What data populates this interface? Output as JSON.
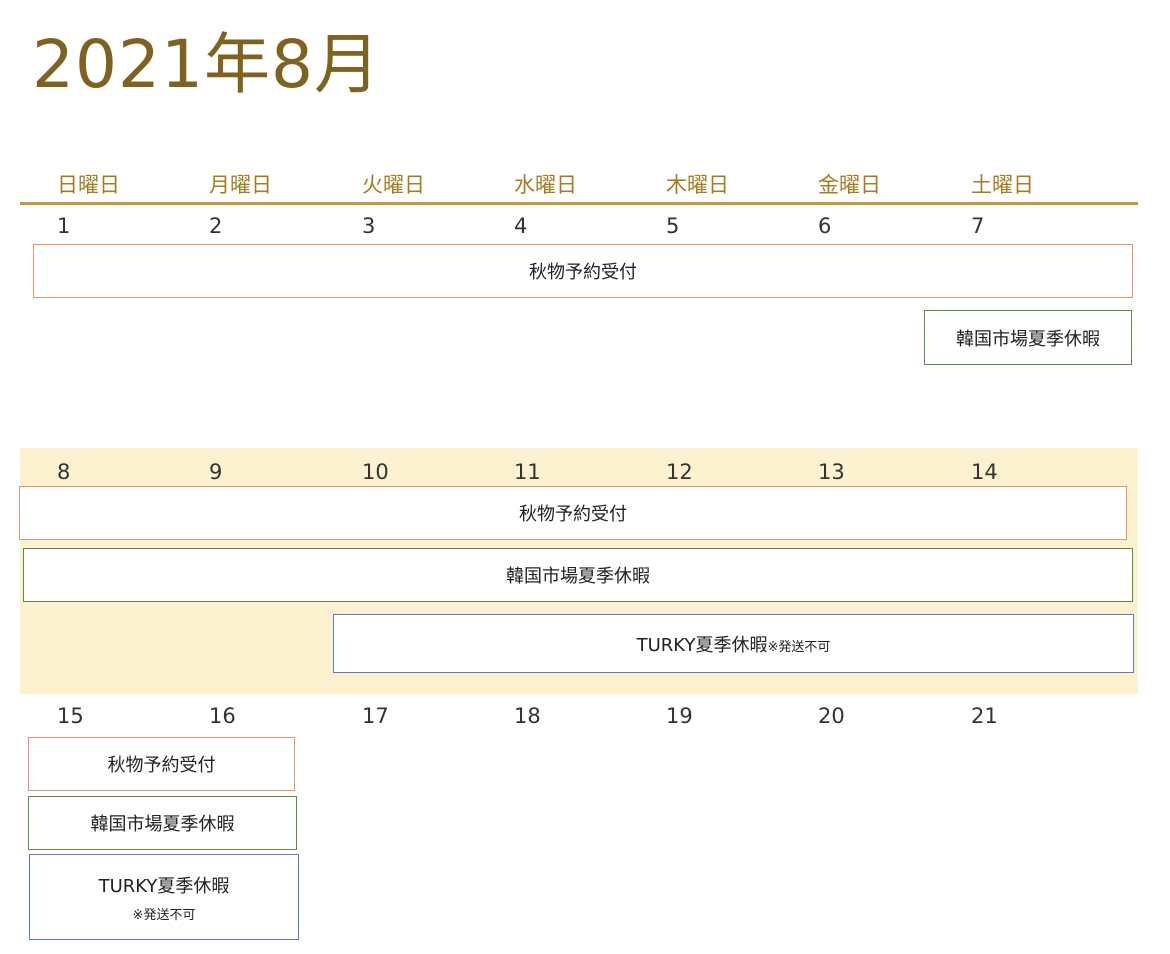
{
  "title": "2021年8月",
  "weekdays": [
    "日曜日",
    "月曜日",
    "火曜日",
    "水曜日",
    "木曜日",
    "金曜日",
    "土曜日"
  ],
  "weeks": [
    {
      "days": [
        "1",
        "2",
        "3",
        "4",
        "5",
        "6",
        "7"
      ]
    },
    {
      "days": [
        "8",
        "9",
        "10",
        "11",
        "12",
        "13",
        "14"
      ]
    },
    {
      "days": [
        "15",
        "16",
        "17",
        "18",
        "19",
        "20",
        "21"
      ]
    }
  ],
  "events": {
    "autumn_reservation": "秋物予約受付",
    "korea_holiday": "韓国市場夏季休暇",
    "turky_holiday": "TURKY夏季休暇",
    "no_shipping_note": "※発送不可"
  },
  "colors": {
    "title": "#7f6120",
    "weekday": "#a47d20",
    "header_rule": "#c49a3c",
    "week_band": "#fdf2d0",
    "autumn_border": "#e8936a",
    "korea_border": "#5f8a45",
    "turky_border": "#5a7fc9"
  }
}
